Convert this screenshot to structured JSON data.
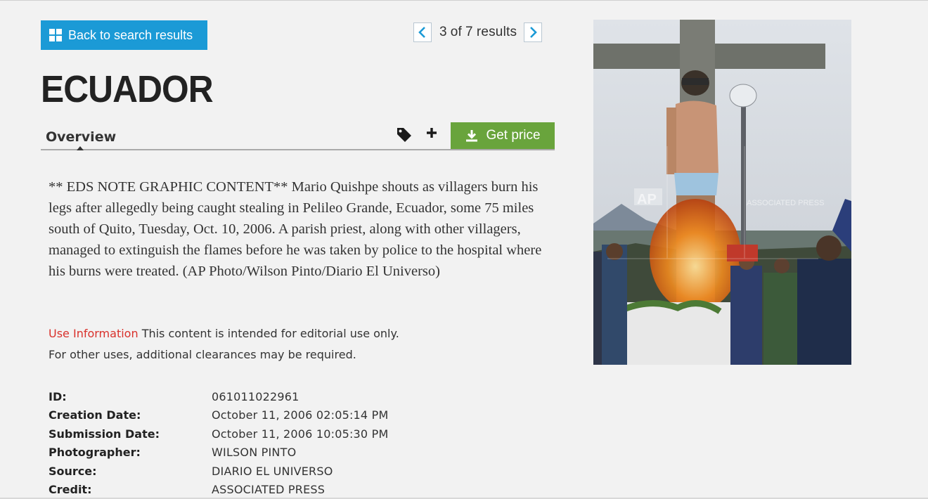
{
  "nav": {
    "back_label": "Back to search results",
    "pager": {
      "current": "3",
      "of": "of",
      "total": "7",
      "results_label": "results"
    }
  },
  "title": "ECUADOR",
  "tabs": {
    "overview_label": "Overview"
  },
  "actions": {
    "get_price_label": "Get price"
  },
  "description": "** EDS NOTE GRAPHIC CONTENT** Mario Quishpe shouts as villagers burn his legs after allegedly being caught stealing in Pelileo Grande, Ecuador, some 75 miles south of Quito, Tuesday, Oct. 10, 2006. A parish priest, along with other villagers, managed to extinguish the flames before he was taken by police to the hospital where his burns were treated. (AP Photo/Wilson Pinto/Diario El Universo)",
  "use_information": {
    "label": "Use Information",
    "text": "This content is intended for editorial use only.",
    "text2": "For other uses, additional clearances may be required."
  },
  "metadata": [
    {
      "key": "ID:",
      "value": "061011022961"
    },
    {
      "key": "Creation Date:",
      "value": "October 11, 2006 02:05:14 PM"
    },
    {
      "key": "Submission Date:",
      "value": "October 11, 2006 10:05:30 PM"
    },
    {
      "key": "Photographer:",
      "value": "WILSON PINTO"
    },
    {
      "key": "Source:",
      "value": "DIARIO EL UNIVERSO"
    },
    {
      "key": "Credit:",
      "value": "ASSOCIATED PRESS"
    }
  ],
  "photo": {
    "watermark_logo": "AP",
    "watermark_text": "ASSOCIATED PRESS"
  },
  "colors": {
    "primary_blue": "#1b9ad6",
    "price_green": "#69a43c",
    "use_info_red": "#d9312b"
  },
  "icons": [
    "grid-icon",
    "chevron-left-icon",
    "chevron-right-icon",
    "tag-icon",
    "plus-icon",
    "download-icon"
  ]
}
